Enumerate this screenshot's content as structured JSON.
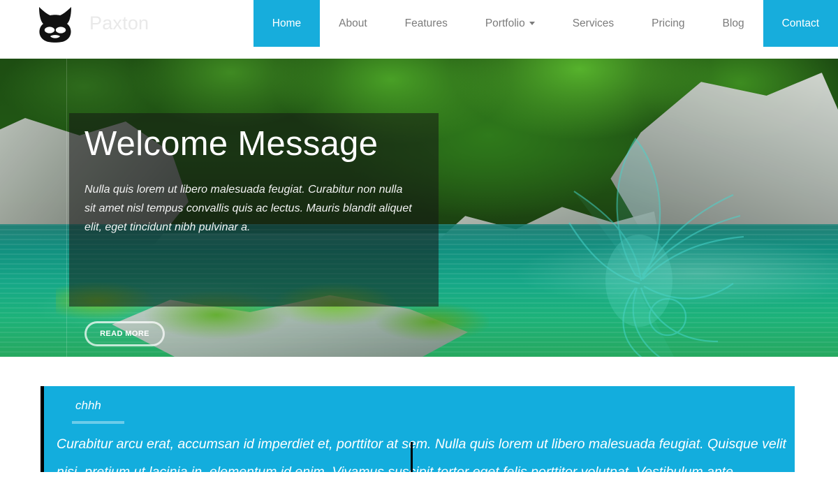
{
  "theme": {
    "accent": "#17ADDC",
    "panel_blue": "#13ADDD",
    "brand_text": "#e9e9e9",
    "nav_text": "#7b7b7b",
    "bar_black": "#000000"
  },
  "header": {
    "brand": {
      "name": "Paxton",
      "logo_icon": "cat-mask-logo-icon"
    },
    "nav": [
      {
        "label": "Home",
        "state": "active",
        "has_caret": false
      },
      {
        "label": "About",
        "state": "default",
        "has_caret": false
      },
      {
        "label": "Features",
        "state": "default",
        "has_caret": false
      },
      {
        "label": "Portfolio",
        "state": "default",
        "has_caret": true
      },
      {
        "label": "Services",
        "state": "default",
        "has_caret": false
      },
      {
        "label": "Pricing",
        "state": "default",
        "has_caret": false
      },
      {
        "label": "Blog",
        "state": "default",
        "has_caret": false
      },
      {
        "label": "Contact",
        "state": "hot",
        "has_caret": false
      }
    ]
  },
  "hero": {
    "image_description": "Emerald green river between grey rocks and lush trees with translucent teal butterfly overlay",
    "caption": {
      "title": "Welcome Message",
      "text": "Nulla quis lorem ut libero malesuada feugiat. Curabitur non nulla sit amet nisl tempus convallis quis ac lectus. Mauris blandit aliquet elit, eget tincidunt nibh pulvinar a.",
      "button_label": "READ MORE"
    },
    "carousel": {
      "slide_count": 5,
      "active_index": 0,
      "indicator_active_color": "#ffffff",
      "indicator_inactive_color": "#101010"
    }
  },
  "panel": {
    "heading": "chhh",
    "body": "Curabitur arcu erat, accumsan id imperdiet et, porttitor at sem. Nulla quis lorem ut libero malesuada feugiat. Quisque velit nisi, pretium ut lacinia in, elementum id enim. Vivamus suscipit tortor eget felis porttitor volutpat. Vestibulum ante"
  }
}
